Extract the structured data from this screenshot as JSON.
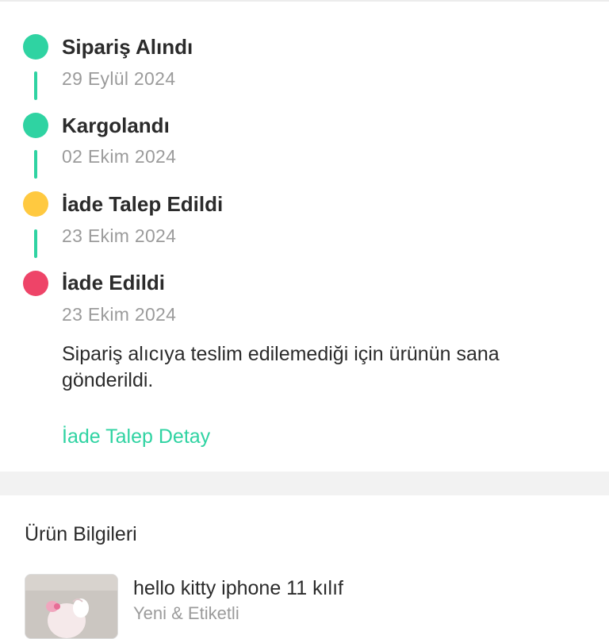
{
  "timeline": {
    "steps": [
      {
        "title": "Sipariş Alındı",
        "date": "29 Eylül 2024",
        "color": "#2fd3a2"
      },
      {
        "title": "Kargolandı",
        "date": "02 Ekim 2024",
        "color": "#2fd3a2"
      },
      {
        "title": "İade Talep Edildi",
        "date": "23 Ekim 2024",
        "color": "#ffc940"
      },
      {
        "title": "İade Edildi",
        "date": "23 Ekim 2024",
        "color": "#ee4468"
      }
    ],
    "connector_color": "#2fd3a2",
    "note": "Sipariş alıcıya teslim edilemediği için ürünün sana gönderildi.",
    "detail_link": "İade Talep Detay",
    "link_color": "#2fd3a2"
  },
  "product_section": {
    "title": "Ürün Bilgileri",
    "product": {
      "name": "hello kitty iphone 11 kılıf",
      "subtitle": "Yeni & Etiketli"
    }
  }
}
